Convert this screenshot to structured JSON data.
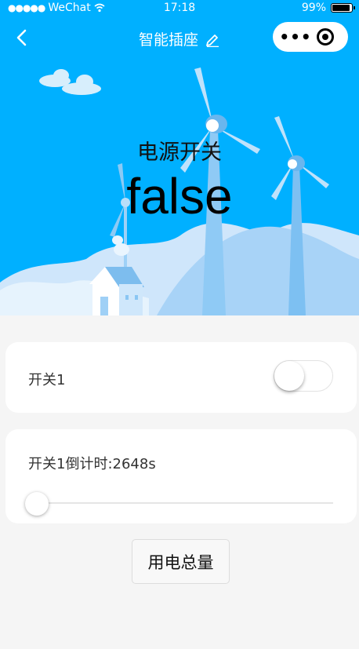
{
  "status_bar": {
    "signal_dots": "●●●●●",
    "carrier": "WeChat",
    "time": "17:18",
    "battery_percent": "99%",
    "battery_level": 0.99
  },
  "navbar": {
    "title": "智能插座",
    "back_icon": "chevron-left-icon",
    "edit_icon": "pencil-icon",
    "more_icon": "more-dots-icon",
    "close_icon": "target-icon",
    "more_glyph": "•••"
  },
  "hero": {
    "label": "电源开关",
    "value": "false",
    "background_color": "#00b0ff"
  },
  "switch1": {
    "label": "开关1",
    "checked": false
  },
  "countdown": {
    "label": "开关1倒计时:2648s",
    "slider_value": 0
  },
  "buttons": {
    "total_power": "用电总量"
  }
}
